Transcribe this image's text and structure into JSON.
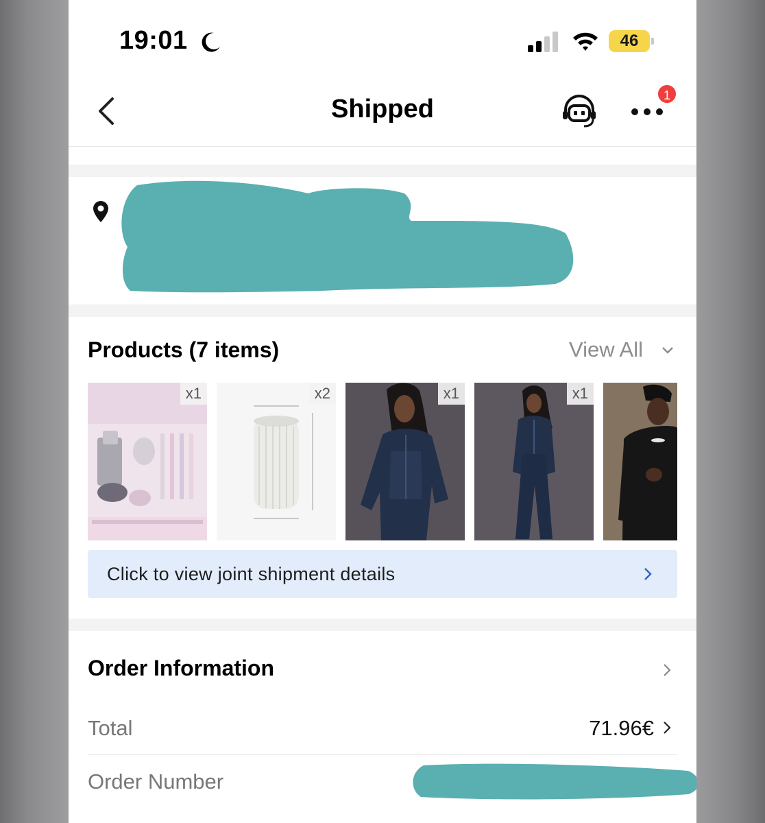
{
  "status_bar": {
    "time": "19:01",
    "battery": "46",
    "icons": [
      "moon-icon",
      "signal-icon",
      "wifi-icon",
      "battery-icon"
    ]
  },
  "nav": {
    "title": "Shipped",
    "badge_count": "1",
    "icons": [
      "back-icon",
      "customer-service-icon",
      "more-icon"
    ]
  },
  "products": {
    "title": "Products (7 items)",
    "view_all": "View All",
    "items": [
      {
        "name": "pen-set-product",
        "qty": "x1"
      },
      {
        "name": "vase-product",
        "qty": "x2"
      },
      {
        "name": "denim-set-product-1",
        "qty": "x1"
      },
      {
        "name": "denim-set-product-2",
        "qty": "x1"
      },
      {
        "name": "sweatshirt-product",
        "qty": ""
      }
    ],
    "joint_shipment": "Click to view joint shipment details"
  },
  "order_info": {
    "title": "Order Information",
    "total_label": "Total",
    "total_value": "71.96€",
    "order_number_label": "Order Number"
  },
  "colors": {
    "redaction": "#5aafb1",
    "badge": "#f03d3d",
    "battery": "#f7d54a",
    "joint_bg": "#e3ecfb",
    "link_chevron": "#2b66c9"
  }
}
